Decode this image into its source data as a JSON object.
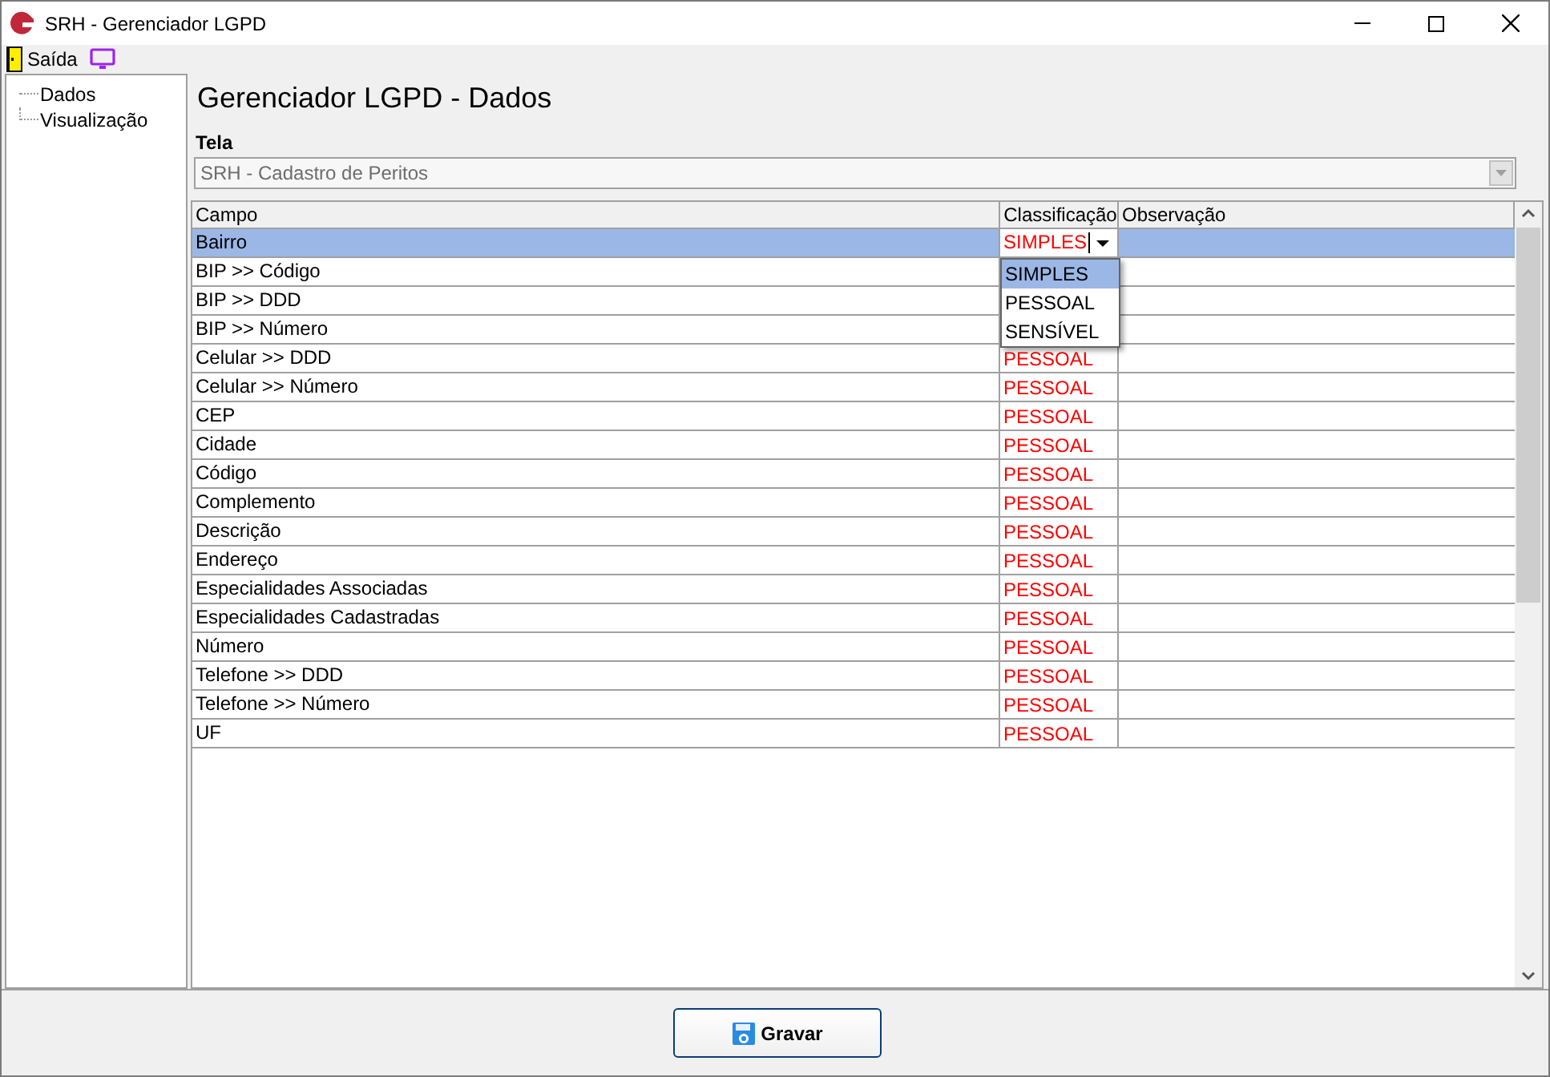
{
  "window": {
    "title": "SRH - Gerenciador LGPD"
  },
  "menu": [
    {
      "kind": "door",
      "label": "Saída"
    },
    {
      "kind": "monitor"
    }
  ],
  "sidebar": {
    "items": [
      {
        "label": "Dados",
        "selected": false
      },
      {
        "label": "Visualização",
        "selected": false
      }
    ]
  },
  "heading": "Gerenciador LGPD - Dados",
  "screen_field": {
    "label": "Tela",
    "value": "SRH - Cadastro de Peritos",
    "disabled": true
  },
  "table": {
    "columns": [
      "Campo",
      "Classificação",
      "Observação"
    ],
    "rows": [
      {
        "campo": "Bairro",
        "classificacao": "SIMPLES",
        "selected": true,
        "editing": true
      },
      {
        "campo": "BIP >> Código",
        "selected": false
      },
      {
        "campo": "BIP >> DDD",
        "selected": false
      },
      {
        "campo": "BIP >> Número",
        "selected": false
      },
      {
        "campo": "Celular >> DDD",
        "classificacao": "PESSOAL",
        "selected": false
      },
      {
        "campo": "Celular >> Número",
        "classificacao": "PESSOAL",
        "selected": false
      },
      {
        "campo": "CEP",
        "classificacao": "PESSOAL",
        "selected": false
      },
      {
        "campo": "Cidade",
        "classificacao": "PESSOAL",
        "selected": false
      },
      {
        "campo": "Código",
        "classificacao": "PESSOAL",
        "selected": false
      },
      {
        "campo": "Complemento",
        "classificacao": "PESSOAL",
        "selected": false
      },
      {
        "campo": "Descrição",
        "classificacao": "PESSOAL",
        "selected": false
      },
      {
        "campo": "Endereço",
        "classificacao": "PESSOAL",
        "selected": false
      },
      {
        "campo": "Especialidades Associadas",
        "classificacao": "PESSOAL",
        "selected": false
      },
      {
        "campo": "Especialidades Cadastradas",
        "classificacao": "PESSOAL",
        "selected": false
      },
      {
        "campo": "Número",
        "classificacao": "PESSOAL",
        "selected": false
      },
      {
        "campo": "Telefone >> DDD",
        "classificacao": "PESSOAL",
        "selected": false
      },
      {
        "campo": "Telefone >> Número",
        "classificacao": "PESSOAL",
        "selected": false
      },
      {
        "campo": "UF",
        "classificacao": "PESSOAL",
        "selected": false
      }
    ]
  },
  "dropdown": {
    "options": [
      {
        "label": "SIMPLES",
        "selected": true
      },
      {
        "label": "PESSOAL",
        "selected": false
      },
      {
        "label": "SENSÍVEL",
        "selected": false
      }
    ]
  },
  "save_button": {
    "label": "Gravar"
  }
}
